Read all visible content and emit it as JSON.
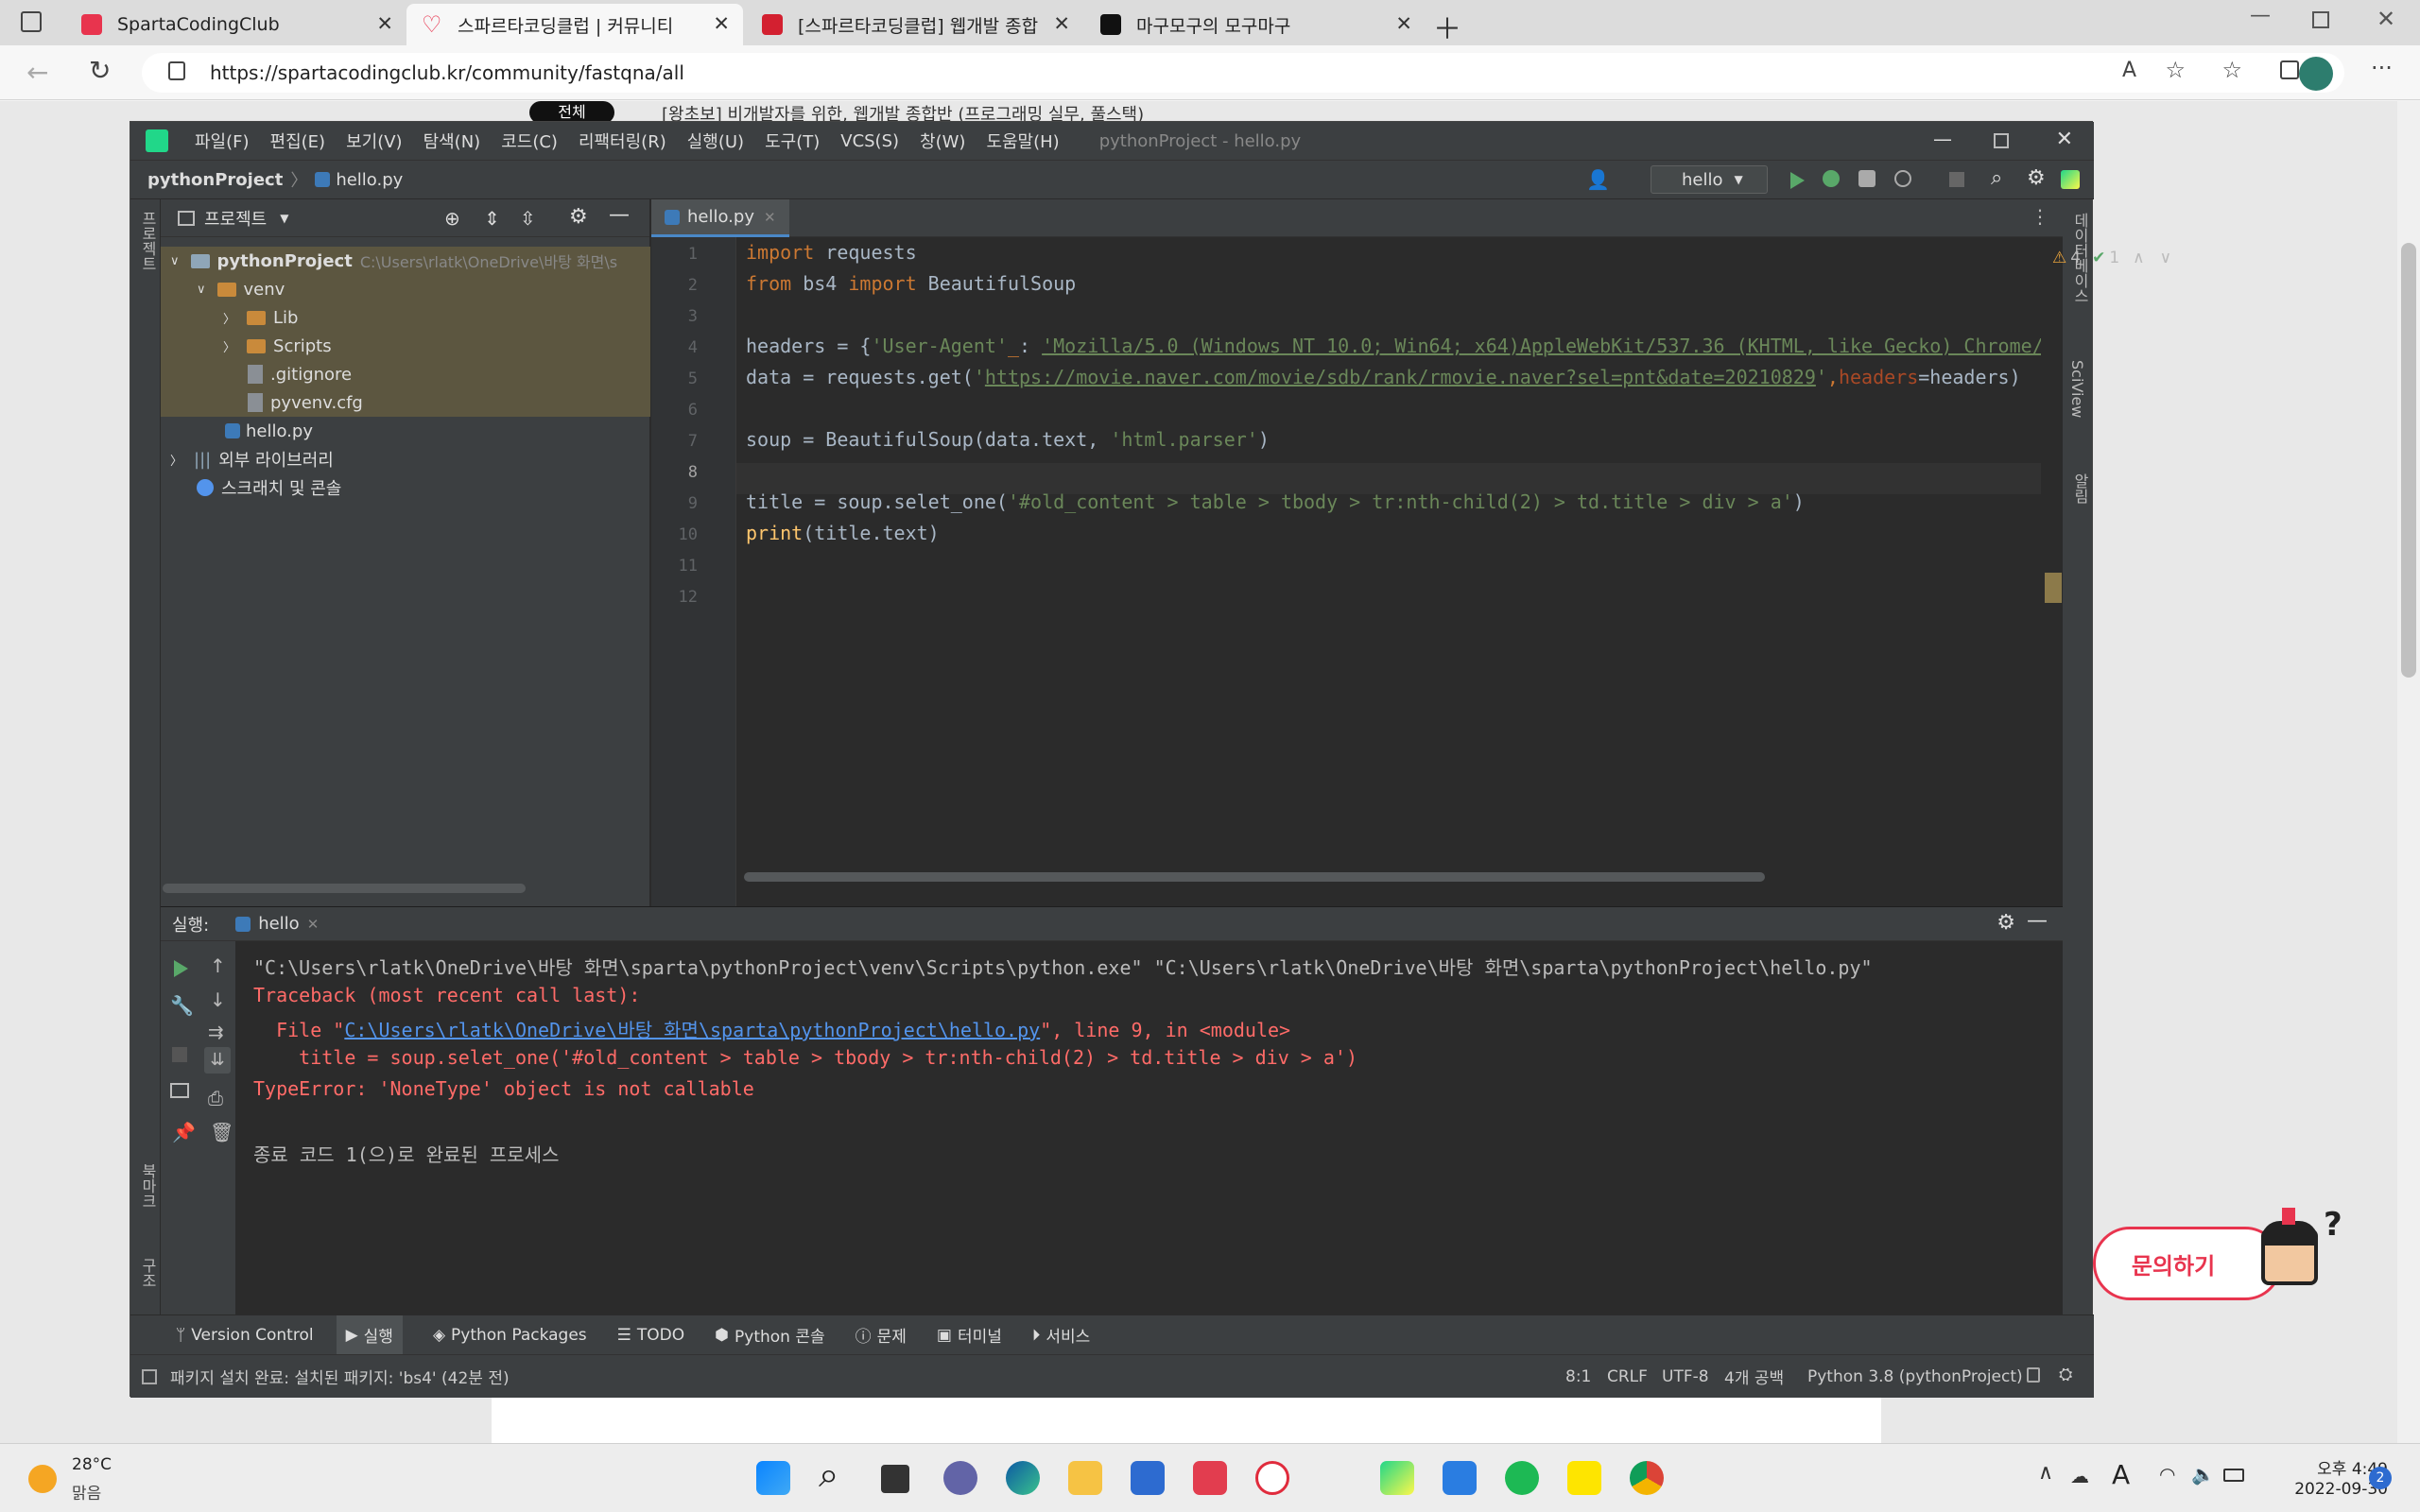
{
  "browser": {
    "tabs": [
      {
        "title": "SpartaCodingClub",
        "color": "#e8344e"
      },
      {
        "title": "스파르타코딩클럽 | 커뮤니티",
        "color": "#e8344e"
      },
      {
        "title": "[스파르타코딩클럽] 웹개발 종합",
        "color": "#d32030"
      },
      {
        "title": "마구모구의 모구마구",
        "color": "#111111"
      }
    ],
    "url": "https://spartacodingclub.kr/community/fastqna/all"
  },
  "web_bg": {
    "pill": "전체",
    "text": "[왕초보] 비개발자를 위한, 웹개발 종합반 (프로그래밍 실무, 풀스택)"
  },
  "ide": {
    "menu": [
      "파일(F)",
      "편집(E)",
      "보기(V)",
      "탐색(N)",
      "코드(C)",
      "리팩터링(R)",
      "실행(U)",
      "도구(T)",
      "VCS(S)",
      "창(W)",
      "도움말(H)"
    ],
    "window_title": "pythonProject - hello.py",
    "breadcrumb": {
      "project": "pythonProject",
      "file": "hello.py"
    },
    "run_config": "hello",
    "left_strip": {
      "top": "프로젝트",
      "bookmark": "북마크",
      "structure": "구조"
    },
    "right_strip": {
      "db": "데이터베이스",
      "sciview": "SciView",
      "notify": "알림"
    },
    "project_panel": {
      "title": "프로젝트",
      "tree": [
        {
          "label": "pythonProject",
          "path": "C:\\Users\\rlatk\\OneDrive\\바탕 화면\\s"
        },
        {
          "label": "venv"
        },
        {
          "label": "Lib"
        },
        {
          "label": "Scripts"
        },
        {
          "label": ".gitignore"
        },
        {
          "label": "pyvenv.cfg"
        },
        {
          "label": "hello.py"
        },
        {
          "label": "외부 라이브러리"
        },
        {
          "label": "스크래치 및 콘솔"
        }
      ]
    },
    "editor": {
      "tab": "hello.py",
      "warnings": "4",
      "checks": "1",
      "line_numbers": [
        "1",
        "2",
        "3",
        "4",
        "5",
        "6",
        "7",
        "8",
        "9",
        "10",
        "11",
        "12"
      ]
    },
    "run": {
      "label": "실행:",
      "tab": "hello",
      "cmd": "\"C:\\Users\\rlatk\\OneDrive\\바탕 화면\\sparta\\pythonProject\\venv\\Scripts\\python.exe\" \"C:\\Users\\rlatk\\OneDrive\\바탕 화면\\sparta\\pythonProject\\hello.py\"",
      "tb1": "Traceback (most recent call last):",
      "tb2_pre": "  File \"",
      "tb2_link": "C:\\Users\\rlatk\\OneDrive\\바탕 화면\\sparta\\pythonProject\\hello.py",
      "tb2_post": "\", line 9, in <module>",
      "tb3": "    title = soup.selet_one('#old_content > table > tbody > tr:nth-child(2) > td.title > div > a')",
      "tb4": "TypeError: 'NoneType' object is not callable",
      "exit": "종료 코드 1(으)로 완료된 프로세스"
    },
    "bottom_tabs": [
      "Version Control",
      "실행",
      "Python Packages",
      "TODO",
      "Python 콘솔",
      "문제",
      "터미널",
      "서비스"
    ],
    "status": {
      "message": "패키지 설치 완료: 설치된 패키지: 'bs4' (42분 전)",
      "pos": "8:1",
      "eol": "CRLF",
      "enc": "UTF-8",
      "indent": "4개 공백",
      "interp": "Python 3.8 (pythonProject)"
    }
  },
  "chat_button": "문의하기",
  "taskbar": {
    "weather_temp": "28°C",
    "weather_desc": "맑음",
    "time": "오후 4:49",
    "date": "2022-09-30",
    "notif": "2",
    "ime": "A"
  }
}
